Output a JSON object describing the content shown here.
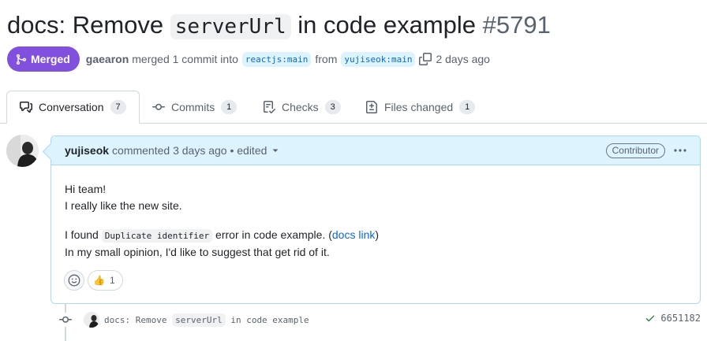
{
  "pr": {
    "title_prefix": "docs: Remove ",
    "title_code": "serverUrl",
    "title_suffix": " in code example",
    "number": "#5791",
    "status": "Merged",
    "author": "gaearon",
    "merged_text": "merged 1 commit into",
    "base_branch": "reactjs:main",
    "from_text": "from",
    "head_branch": "yujiseok:main",
    "time": "2 days ago"
  },
  "tabs": [
    {
      "label": "Conversation",
      "count": "7",
      "icon": "comment-discussion-icon",
      "active": true
    },
    {
      "label": "Commits",
      "count": "1",
      "icon": "git-commit-icon",
      "active": false
    },
    {
      "label": "Checks",
      "count": "3",
      "icon": "checklist-icon",
      "active": false
    },
    {
      "label": "Files changed",
      "count": "1",
      "icon": "file-diff-icon",
      "active": false
    }
  ],
  "comment": {
    "author": "yujiseok",
    "meta": "commented 3 days ago • edited",
    "badge": "Contributor",
    "line1": "Hi team!",
    "line2": "I really like the new site.",
    "found_prefix": "I found ",
    "found_code": "Duplicate identifier",
    "found_mid": " error in code example. (",
    "found_link": "docs link",
    "found_suffix": ")",
    "line4": "In my small opinion, I'd like to suggest that get rid of it.",
    "reaction_emoji": "👍",
    "reaction_count": "1"
  },
  "commit": {
    "msg_prefix": "docs: Remove ",
    "msg_code": "serverUrl",
    "msg_suffix": " in code example",
    "sha": "6651182"
  },
  "colors": {
    "merged": "#8250df",
    "link": "#0969da",
    "comment_header": "#ddf4ff",
    "success": "#1a7f37"
  }
}
